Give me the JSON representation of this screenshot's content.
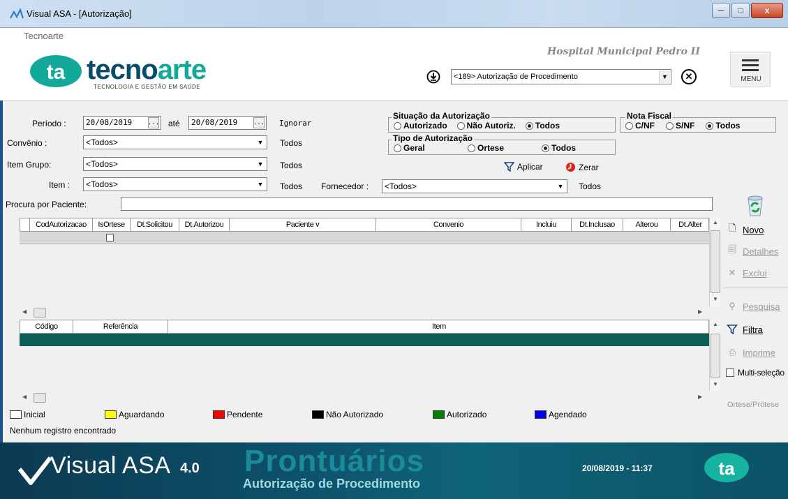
{
  "window": {
    "title": "Visual ASA - [Autorização]",
    "minimize": "─",
    "maximize": "□",
    "close": "x"
  },
  "header": {
    "company_label": "Tecnoarte",
    "logo_mark": "ta",
    "logo_word_a": "tecno",
    "logo_word_b": "arte",
    "logo_tagline": "TECNOLOGIA E GESTÃO EM SAÚDE",
    "hospital": "Hospital Municipal Pedro II",
    "module_select": "<189> Autorização de Procedimento",
    "menu_label": "MENU"
  },
  "filters": {
    "periodo_label": "Período :",
    "periodo_from": "20/08/2019",
    "ate_label": "até",
    "periodo_to": "20/08/2019",
    "date_btn": "...",
    "ignorar": "Ignorar",
    "convenio_label": "Convênio :",
    "convenio_value": "<Todos>",
    "convenio_todos": "Todos",
    "itemgrupo_label": "Item Grupo:",
    "itemgrupo_value": "<Todos>",
    "itemgrupo_todos": "Todos",
    "item_label": "Item :",
    "item_value": "<Todos>",
    "item_todos": "Todos",
    "fornecedor_label": "Fornecedor :",
    "fornecedor_value": "<Todos>",
    "fornecedor_todos": "Todos",
    "paciente_label": "Procura por Paciente:",
    "paciente_value": "",
    "situacao": {
      "title": "Situação da Autorização",
      "opt1": "Autorizado",
      "opt2": "Não Autoriz.",
      "opt3": "Todos",
      "selected": "Todos"
    },
    "nota": {
      "title": "Nota Fiscal",
      "opt1": "C/NF",
      "opt2": "S/NF",
      "opt3": "Todos",
      "selected": "Todos"
    },
    "tipo": {
      "title": "Tipo de Autorização",
      "opt1": "Geral",
      "opt2": "Ortese",
      "opt3": "Todos",
      "selected": "Todos"
    },
    "aplicar": "Aplicar",
    "zerar": "Zerar"
  },
  "grid1": {
    "columns": [
      "CodAutorizacao",
      "IsOrtese",
      "Dt.Solicitou",
      "Dt.Autorizou",
      "Paciente v",
      "Convenio",
      "Incluiu",
      "Dt.Inclusao",
      "Alterou",
      "Dt.Alter"
    ],
    "rows": []
  },
  "grid2": {
    "columns": [
      "Código",
      "Referência",
      "Item"
    ],
    "rows": []
  },
  "side": {
    "novo": "Novo",
    "detalhes": "Detalhes",
    "exclui": "Exclui",
    "pesquisa": "Pesquisa",
    "filtra": "Filtra",
    "imprime": "Imprime",
    "multi": "Multi-seleção",
    "ortese": "Ortese/Prótese"
  },
  "legend": [
    {
      "label": "Inicial",
      "color": "#ffffff"
    },
    {
      "label": "Aguardando",
      "color": "#ffff00"
    },
    {
      "label": "Pendente",
      "color": "#ff0000"
    },
    {
      "label": "Não Autorizado",
      "color": "#000000"
    },
    {
      "label": "Autorizado",
      "color": "#008000"
    },
    {
      "label": "Agendado",
      "color": "#0000ff"
    }
  ],
  "status": "Nenhum registro encontrado",
  "footer": {
    "visual": "Visual ASA",
    "version": "4.0",
    "prontuarios": "Prontuários",
    "subtitle": "Autorização de Procedimento",
    "datetime": "20/08/2019 - 11:37",
    "logo_mark": "ta"
  },
  "colors": {
    "accent": "#13a99a",
    "brand_dark": "#0a4d6b",
    "selected_row": "#0b5e57",
    "footer": "#0d4f68"
  }
}
